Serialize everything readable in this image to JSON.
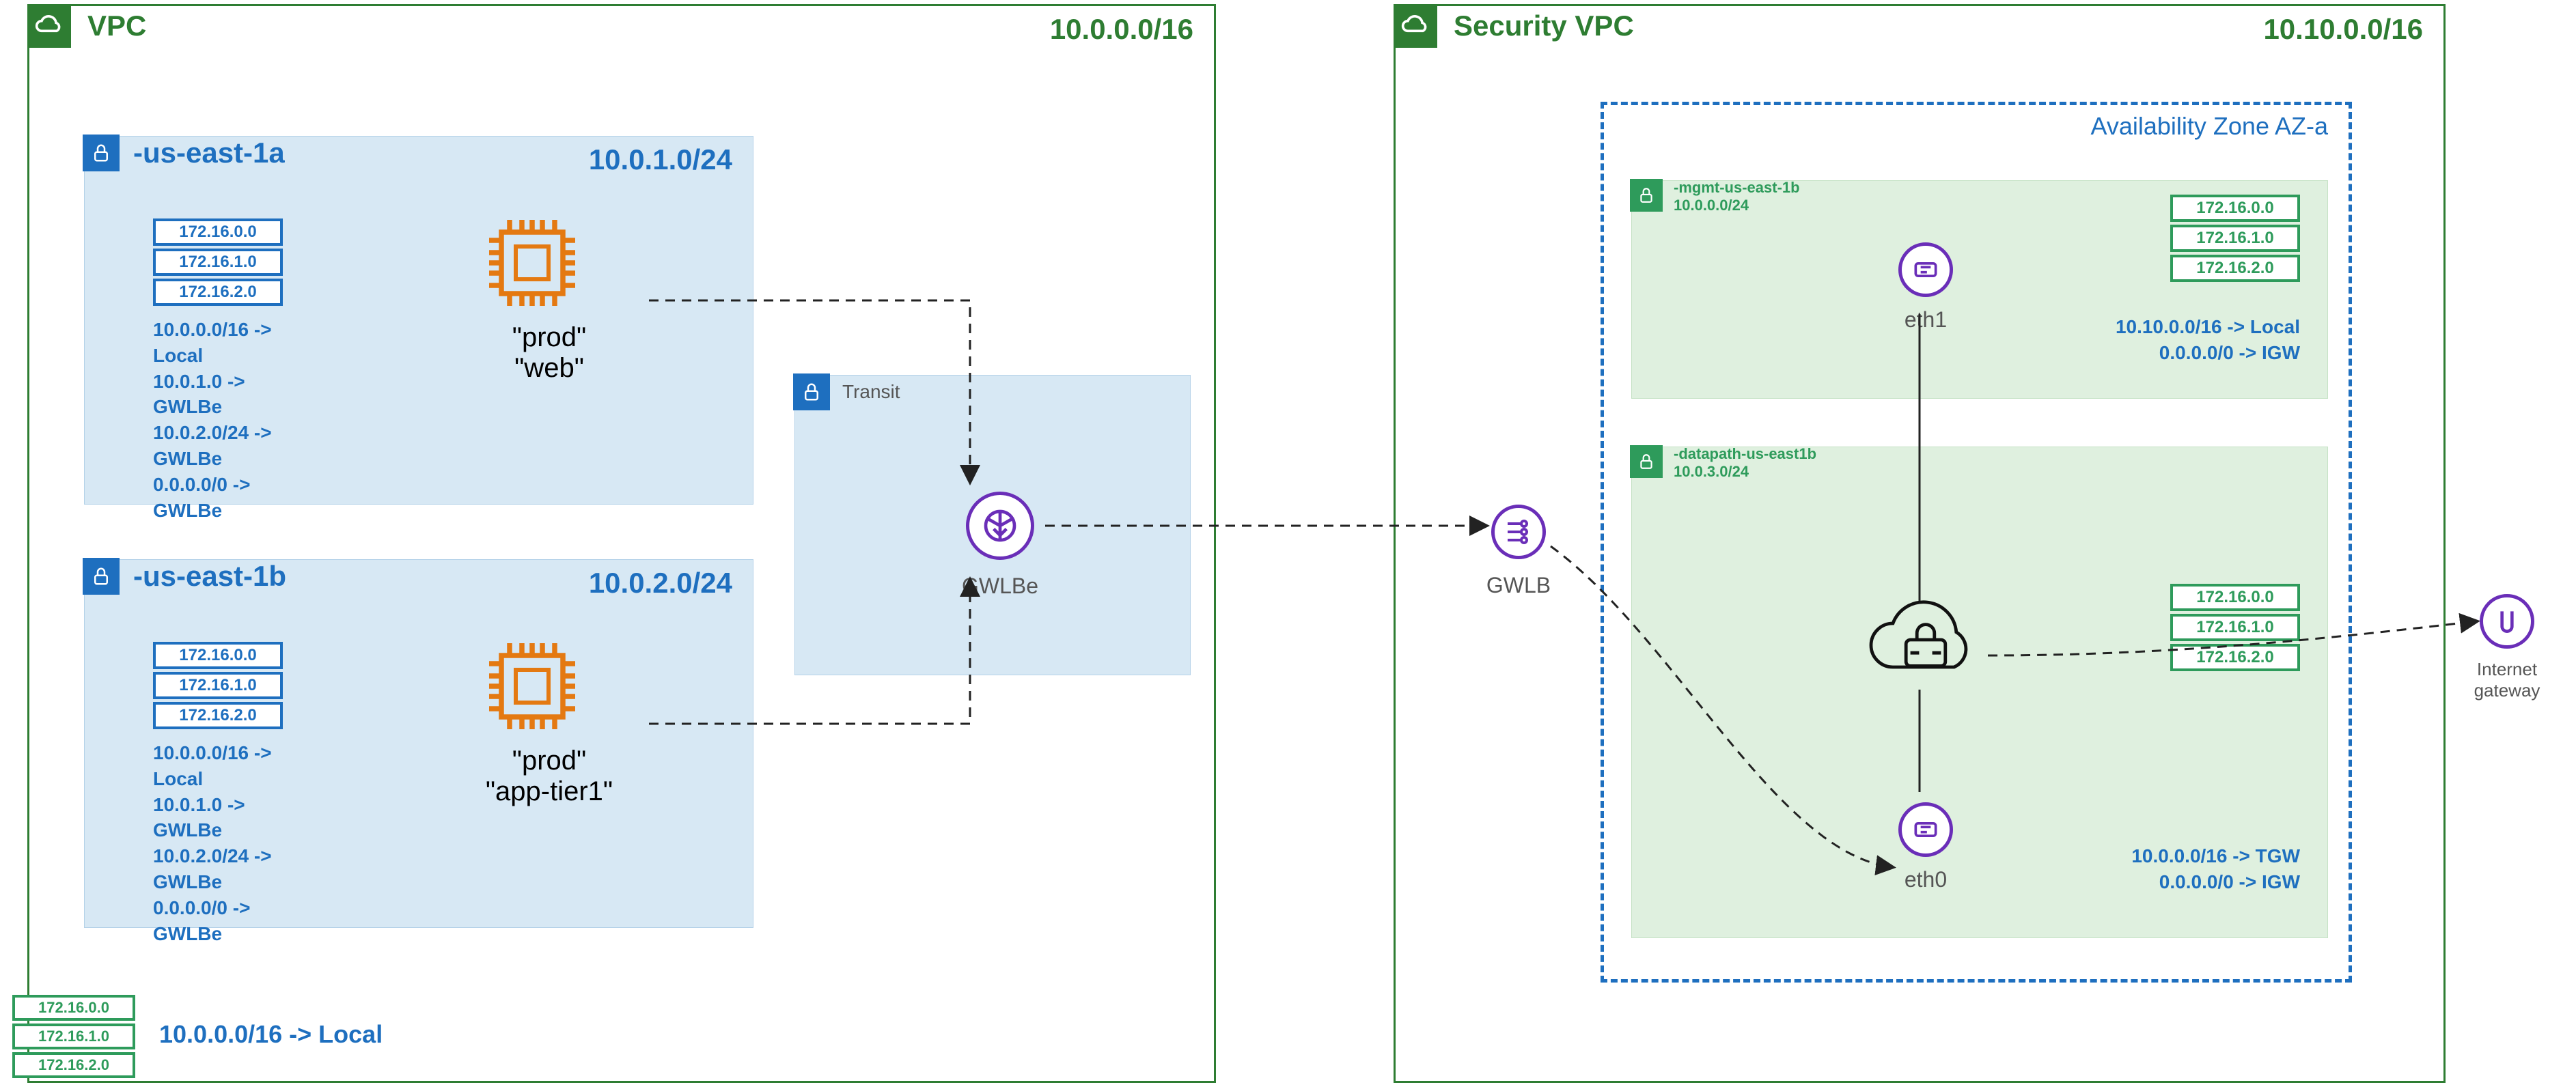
{
  "left_vpc": {
    "title": "VPC",
    "cidr": "10.0.0.0/16",
    "subnet_a": {
      "name": "-us-east-1a",
      "cidr": "10.0.1.0/24",
      "ips": [
        "172.16.0.0",
        "172.16.1.0",
        "172.16.2.0"
      ],
      "routes": [
        "10.0.0.0/16 -> Local",
        "10.0.1.0 -> GWLBe",
        "10.0.2.0/24 -> GWLBe",
        "0.0.0.0/0 -> GWLBe"
      ],
      "tags": [
        "\"prod\"",
        "\"web\""
      ]
    },
    "subnet_b": {
      "name": "-us-east-1b",
      "cidr": "10.0.2.0/24",
      "ips": [
        "172.16.0.0",
        "172.16.1.0",
        "172.16.2.0"
      ],
      "routes": [
        "10.0.0.0/16 -> Local",
        "10.0.1.0 -> GWLBe",
        "10.0.2.0/24 -> GWLBe",
        "0.0.0.0/0 -> GWLBe"
      ],
      "tags": [
        "\"prod\"",
        "\"app-tier1\""
      ]
    },
    "transit": {
      "label": "Transit"
    },
    "gwlbe_label": "GWLBe",
    "outer_ips": [
      "172.16.0.0",
      "172.16.1.0",
      "172.16.2.0"
    ],
    "outer_route": "10.0.0.0/16 -> Local"
  },
  "right_vpc": {
    "title": "Security VPC",
    "cidr": "10.10.0.0/16",
    "az_title": "Availability Zone AZ-a",
    "mgmt": {
      "name": "-mgmt-us-east-1b",
      "cidr": "10.0.0.0/24",
      "ips": [
        "172.16.0.0",
        "172.16.1.0",
        "172.16.2.0"
      ],
      "routes": [
        "10.10.0.0/16 -> Local",
        "0.0.0.0/0 -> IGW"
      ],
      "eth_label": "eth1"
    },
    "datapath": {
      "name": "-datapath-us-east1b",
      "cidr": "10.0.3.0/24",
      "ips": [
        "172.16.0.0",
        "172.16.1.0",
        "172.16.2.0"
      ],
      "routes": [
        "10.0.0.0/16 -> TGW",
        "0.0.0.0/0 -> IGW"
      ],
      "eth_label": "eth0"
    },
    "gwlb_label": "GWLB",
    "igw_label": "Internet gateway"
  }
}
